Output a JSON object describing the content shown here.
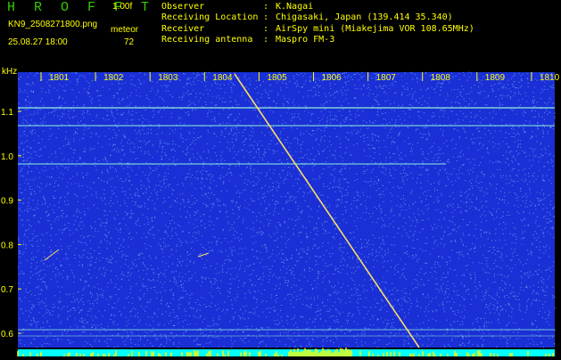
{
  "header": {
    "app_title": "H R O F F T",
    "version": "1.00f",
    "filename": "KN9_2508271800.png",
    "datetime": "25.08.27 18:00",
    "meteor_label": "meteor",
    "meteor_count": "72",
    "info": [
      {
        "key": "Observer",
        "value": "K.Nagai"
      },
      {
        "key": "Receiving Location",
        "value": "Chigasaki, Japan (139.414 35.340)"
      },
      {
        "key": "Receiver",
        "value": "AirSpy mini (Miakejima VOR 108.65MHz)"
      },
      {
        "key": "Receiving antenna",
        "value": "Maspro FM-3"
      }
    ]
  },
  "spectrogram": {
    "unit_label": "kHz",
    "time_ticks": [
      "1801",
      "1802",
      "1803",
      "1804",
      "1805",
      "1806",
      "1807",
      "1808",
      "1809",
      "1810"
    ],
    "freq_ticks": [
      "1.1",
      "1.0",
      "0.9",
      "0.8",
      "0.7",
      "0.6"
    ],
    "colors": {
      "background": "#1a2fd6",
      "noise": "#7fd7ff",
      "axis": "#ffff00",
      "carrier": "#8ff0d8",
      "trail": "#ffdd66",
      "baseline": "#00ffff"
    }
  }
}
